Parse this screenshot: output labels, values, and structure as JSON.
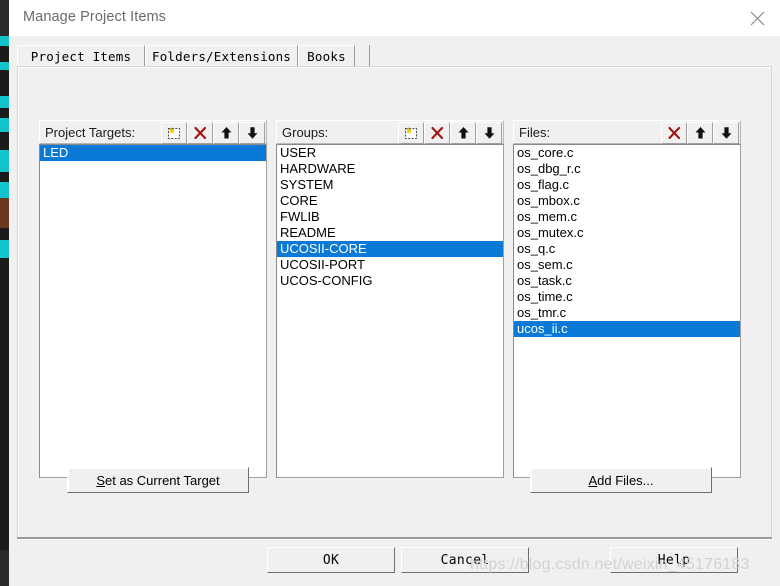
{
  "window": {
    "title": "Manage Project Items",
    "close_icon": "close-icon"
  },
  "tabs": [
    {
      "label": "Project Items",
      "selected": true
    },
    {
      "label": "Folders/Extensions",
      "selected": false
    },
    {
      "label": "Books",
      "selected": false
    }
  ],
  "columns": {
    "targets": {
      "label": "Project Targets:",
      "toolbar": [
        "new-item-icon",
        "delete-icon",
        "move-up-icon",
        "move-down-icon"
      ],
      "items": [
        {
          "label": "LED",
          "selected": true
        }
      ]
    },
    "groups": {
      "label": "Groups:",
      "toolbar": [
        "new-item-icon",
        "delete-icon",
        "move-up-icon",
        "move-down-icon"
      ],
      "items": [
        {
          "label": "USER",
          "selected": false
        },
        {
          "label": "HARDWARE",
          "selected": false
        },
        {
          "label": "SYSTEM",
          "selected": false
        },
        {
          "label": "CORE",
          "selected": false
        },
        {
          "label": "FWLIB",
          "selected": false
        },
        {
          "label": "README",
          "selected": false
        },
        {
          "label": "UCOSII-CORE",
          "selected": true
        },
        {
          "label": "UCOSII-PORT",
          "selected": false
        },
        {
          "label": "UCOS-CONFIG",
          "selected": false
        }
      ]
    },
    "files": {
      "label": "Files:",
      "toolbar": [
        "delete-icon",
        "move-up-icon",
        "move-down-icon"
      ],
      "items": [
        {
          "label": "os_core.c",
          "selected": false
        },
        {
          "label": "os_dbg_r.c",
          "selected": false
        },
        {
          "label": "os_flag.c",
          "selected": false
        },
        {
          "label": "os_mbox.c",
          "selected": false
        },
        {
          "label": "os_mem.c",
          "selected": false
        },
        {
          "label": "os_mutex.c",
          "selected": false
        },
        {
          "label": "os_q.c",
          "selected": false
        },
        {
          "label": "os_sem.c",
          "selected": false
        },
        {
          "label": "os_task.c",
          "selected": false
        },
        {
          "label": "os_time.c",
          "selected": false
        },
        {
          "label": "os_tmr.c",
          "selected": false
        },
        {
          "label": "ucos_ii.c",
          "selected": true
        }
      ]
    }
  },
  "actions": {
    "set_current_target": {
      "accel": "S",
      "rest": "et as Current Target"
    },
    "add_files": {
      "accel": "A",
      "rest": "dd Files..."
    }
  },
  "dialog_buttons": {
    "ok": "OK",
    "cancel": "Cancel",
    "help": "Help"
  },
  "watermark": "https://blog.csdn.net/weixin_45176183",
  "colors": {
    "selection": "#0a7ad6",
    "dialog_face": "#f0f0f0",
    "delete_icon": "#a01414",
    "title_text": "#6b6b6b"
  }
}
